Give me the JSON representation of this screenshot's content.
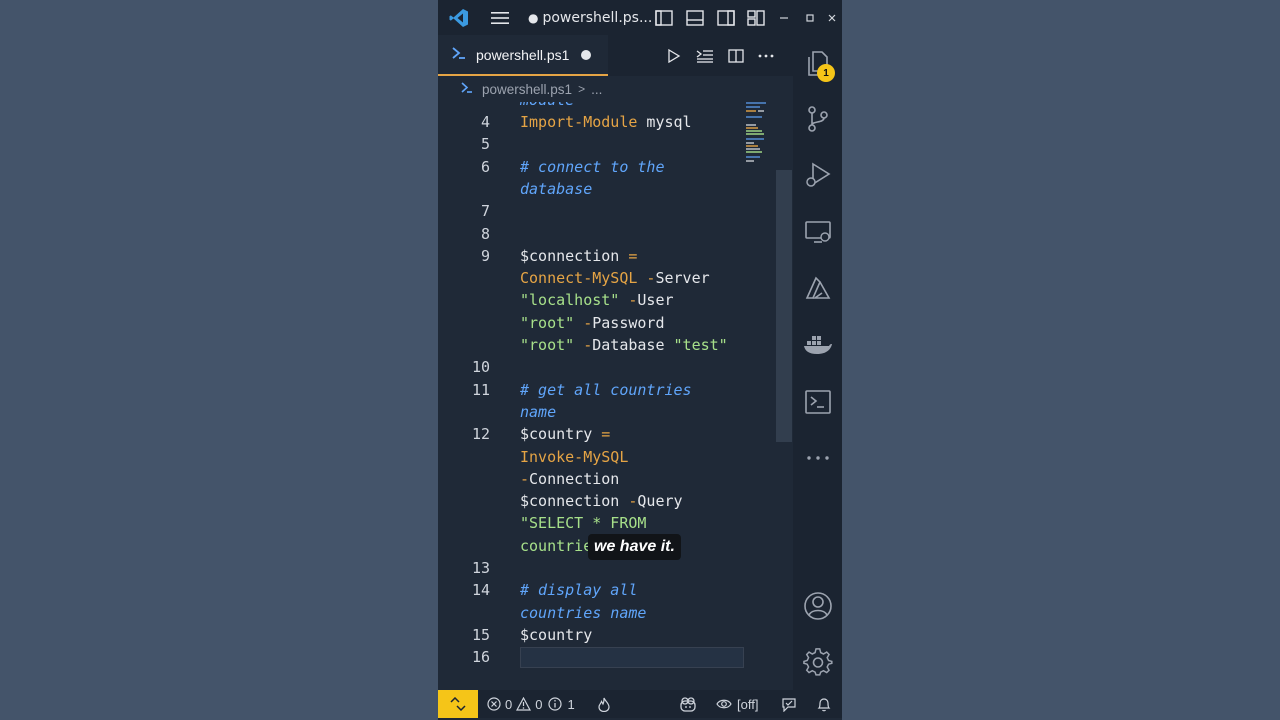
{
  "window": {
    "title": "powershell.ps...",
    "modified_dot": "●"
  },
  "tab": {
    "label": "powershell.ps1"
  },
  "breadcrumb": {
    "file": "powershell.ps1",
    "chevron": ">",
    "more": "..."
  },
  "editor": {
    "partial_top": "module",
    "lines": [
      {
        "n": "4",
        "tokens": [
          {
            "t": "Import-Module",
            "c": "kw"
          },
          {
            "t": " mysql",
            "c": "var"
          }
        ]
      },
      {
        "n": "5",
        "tokens": []
      },
      {
        "n": "6",
        "tokens": [
          {
            "t": "# connect to the",
            "c": "cm"
          }
        ]
      },
      {
        "n": "",
        "tokens": [
          {
            "t": "database",
            "c": "cm"
          }
        ]
      },
      {
        "n": "7",
        "tokens": []
      },
      {
        "n": "8",
        "tokens": []
      },
      {
        "n": "9",
        "tokens": [
          {
            "t": "$connection",
            "c": "var"
          },
          {
            "t": " =",
            "c": "op"
          }
        ]
      },
      {
        "n": "",
        "tokens": [
          {
            "t": "Connect-MySQL",
            "c": "kw"
          },
          {
            "t": " -",
            "c": "op"
          },
          {
            "t": "Server",
            "c": "var"
          }
        ]
      },
      {
        "n": "",
        "tokens": [
          {
            "t": "\"localhost\"",
            "c": "str"
          },
          {
            "t": " -",
            "c": "op"
          },
          {
            "t": "User",
            "c": "var"
          }
        ]
      },
      {
        "n": "",
        "tokens": [
          {
            "t": "\"root\"",
            "c": "str"
          },
          {
            "t": " -",
            "c": "op"
          },
          {
            "t": "Password",
            "c": "var"
          }
        ]
      },
      {
        "n": "",
        "tokens": [
          {
            "t": "\"root\"",
            "c": "str"
          },
          {
            "t": " -",
            "c": "op"
          },
          {
            "t": "Database ",
            "c": "var"
          },
          {
            "t": "\"test\"",
            "c": "str"
          }
        ]
      },
      {
        "n": "10",
        "tokens": []
      },
      {
        "n": "11",
        "tokens": [
          {
            "t": "# get all countries",
            "c": "cm"
          }
        ]
      },
      {
        "n": "",
        "tokens": [
          {
            "t": "name",
            "c": "cm"
          }
        ]
      },
      {
        "n": "12",
        "tokens": [
          {
            "t": "$country",
            "c": "var"
          },
          {
            "t": " =",
            "c": "op"
          }
        ]
      },
      {
        "n": "",
        "tokens": [
          {
            "t": "Invoke-MySQL",
            "c": "kw"
          }
        ]
      },
      {
        "n": "",
        "tokens": [
          {
            "t": "-",
            "c": "op"
          },
          {
            "t": "Connection",
            "c": "var"
          }
        ]
      },
      {
        "n": "",
        "tokens": [
          {
            "t": "$connection",
            "c": "var"
          },
          {
            "t": " -",
            "c": "op"
          },
          {
            "t": "Query",
            "c": "var"
          }
        ]
      },
      {
        "n": "",
        "tokens": [
          {
            "t": "\"SELECT * FROM",
            "c": "str"
          }
        ]
      },
      {
        "n": "",
        "tokens": [
          {
            "t": "countries\"",
            "c": "str"
          }
        ]
      },
      {
        "n": "13",
        "tokens": []
      },
      {
        "n": "14",
        "tokens": [
          {
            "t": "# display all",
            "c": "cm"
          }
        ]
      },
      {
        "n": "",
        "tokens": [
          {
            "t": "countries name",
            "c": "cm"
          }
        ]
      },
      {
        "n": "15",
        "tokens": [
          {
            "t": "$country",
            "c": "var"
          }
        ]
      },
      {
        "n": "16",
        "tokens": []
      }
    ]
  },
  "caption": {
    "text": "we have it."
  },
  "activity": {
    "explorer_badge": "1"
  },
  "statusbar": {
    "errors": "0",
    "warnings": "0",
    "infos": "1",
    "spell": "[off]"
  },
  "colors": {
    "accent": "#e5a445",
    "badge": "#f5c518",
    "keyword": "#e5a445",
    "string": "#a7e08a",
    "comment": "#60a5fa"
  }
}
